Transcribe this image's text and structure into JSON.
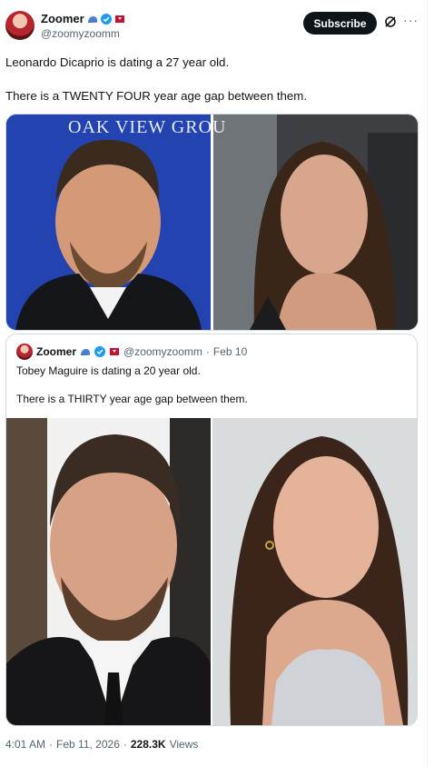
{
  "header": {
    "display_name": "Zoomer",
    "handle": "@zoomyzoomm",
    "subscribe_label": "Subscribe",
    "more_label": "···"
  },
  "tweet": {
    "line1": "Leonardo Dicaprio is dating a 27 year old.",
    "line2": "There is a TWENTY FOUR year age gap between them.",
    "image_sign_text": "OAK VIEW GROU"
  },
  "quote": {
    "display_name": "Zoomer",
    "handle": "@zoomyzoomm",
    "separator": "·",
    "date": "Feb 10",
    "line1": "Tobey Maguire is dating a 20 year old.",
    "line2": "There is a THIRTY year age gap between them."
  },
  "footer": {
    "time": "4:01 AM",
    "separator1": "·",
    "date": "Feb 11, 2026",
    "separator2": "·",
    "views_count": "228.3K",
    "views_label": "Views"
  },
  "colors": {
    "accent_dark": "#0f1419",
    "muted": "#536471",
    "verified_blue": "#1d9bf0",
    "border": "#cfd9de"
  },
  "icons": [
    "blue-cap-icon",
    "verified-badge-icon",
    "red-flag-icon",
    "grok-icon",
    "more-icon"
  ]
}
